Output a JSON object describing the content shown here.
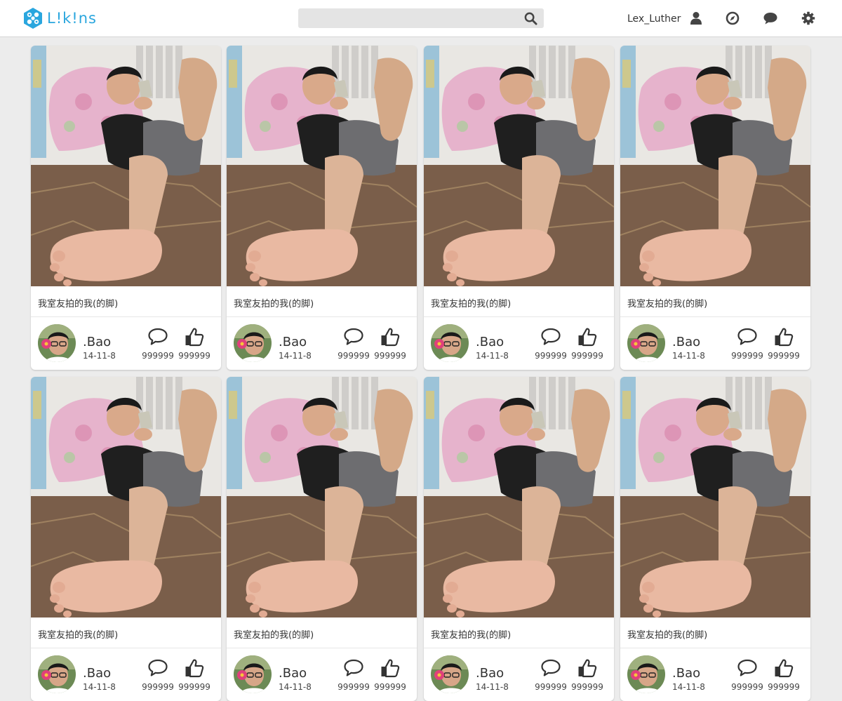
{
  "header": {
    "logo_text": "L!k!ns",
    "search": {
      "value": "",
      "placeholder": ""
    },
    "username": "Lex_Luther",
    "icons": [
      "user-icon",
      "compass-icon",
      "chat-icon",
      "gear-icon"
    ]
  },
  "colors": {
    "brand": "#2aa6de",
    "page_background": "#ececec",
    "topbar_background": "#ffffff",
    "search_background": "#e4e4e4"
  },
  "cards": [
    {
      "caption": "我室友拍的我(的脚)",
      "author": ".Bao",
      "date": "14-11-8",
      "comments": "999999",
      "likes": "999999"
    },
    {
      "caption": "我室友拍的我(的脚)",
      "author": ".Bao",
      "date": "14-11-8",
      "comments": "999999",
      "likes": "999999"
    },
    {
      "caption": "我室友拍的我(的脚)",
      "author": ".Bao",
      "date": "14-11-8",
      "comments": "999999",
      "likes": "999999"
    },
    {
      "caption": "我室友拍的我(的脚)",
      "author": ".Bao",
      "date": "14-11-8",
      "comments": "999999",
      "likes": "999999"
    },
    {
      "caption": "我室友拍的我(的脚)",
      "author": ".Bao",
      "date": "14-11-8",
      "comments": "999999",
      "likes": "999999"
    },
    {
      "caption": "我室友拍的我(的脚)",
      "author": ".Bao",
      "date": "14-11-8",
      "comments": "999999",
      "likes": "999999"
    },
    {
      "caption": "我室友拍的我(的脚)",
      "author": ".Bao",
      "date": "14-11-8",
      "comments": "999999",
      "likes": "999999"
    },
    {
      "caption": "我室友拍的我(的脚)",
      "author": ".Bao",
      "date": "14-11-8",
      "comments": "999999",
      "likes": "999999"
    }
  ]
}
